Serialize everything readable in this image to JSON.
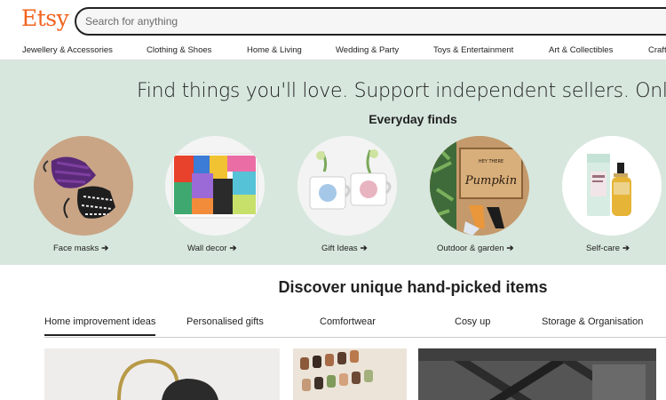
{
  "header": {
    "logo": "Etsy",
    "search_placeholder": "Search for anything"
  },
  "categories": [
    "Jewellery & Accessories",
    "Clothing & Shoes",
    "Home & Living",
    "Wedding & Party",
    "Toys & Entertainment",
    "Art & Collectibles",
    "Craft"
  ],
  "hero": {
    "title": "Find things you'll love. Support independent sellers. Only on Et",
    "subtitle": "Everyday finds",
    "items": [
      {
        "label": "Face masks",
        "arrow": "➔"
      },
      {
        "label": "Wall decor",
        "arrow": "➔"
      },
      {
        "label": "Gift Ideas",
        "arrow": "➔"
      },
      {
        "label": "Outdoor & garden",
        "arrow": "➔"
      },
      {
        "label": "Self-care",
        "arrow": "➔"
      }
    ],
    "doormat_text": "HEY THERE Pumpkin",
    "colors": {
      "background": "#d7e7dd",
      "brand": "#f1641e"
    }
  },
  "discover": {
    "title": "Discover unique hand-picked items",
    "tabs": [
      "Home improvement ideas",
      "Personalised gifts",
      "Comfortwear",
      "Cosy up",
      "Storage & Organisation"
    ],
    "active_tab": "Home improvement ideas"
  }
}
